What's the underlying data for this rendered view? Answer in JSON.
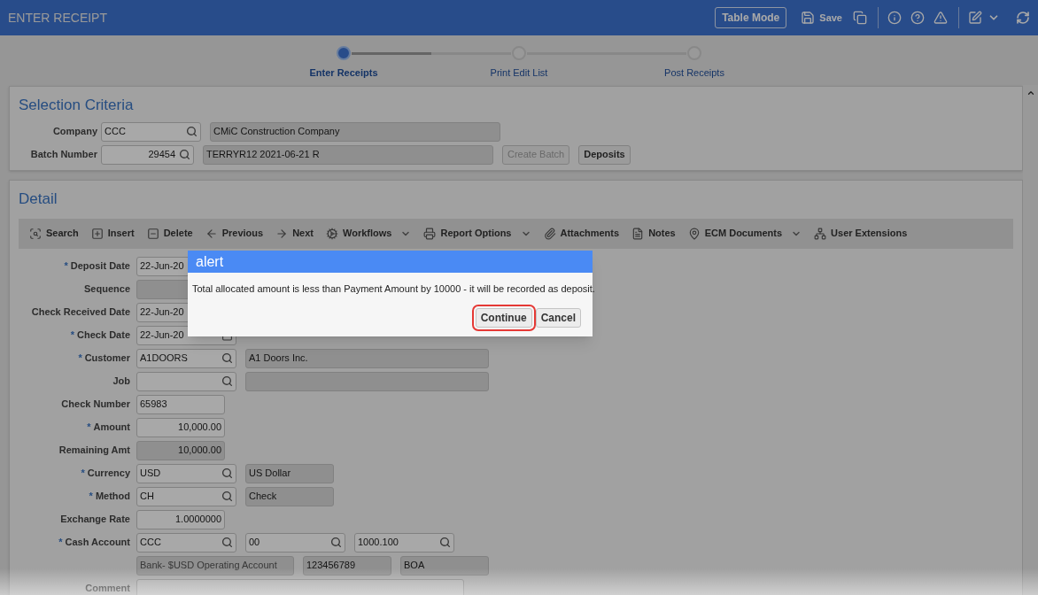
{
  "header": {
    "title": "ENTER RECEIPT",
    "table_mode": "Table Mode",
    "save": "Save"
  },
  "stepper": {
    "level": 0.5,
    "steps": [
      {
        "label": "Enter Receipts",
        "selected": true
      },
      {
        "label": "Print Edit List",
        "selected": false
      },
      {
        "label": "Post Receipts",
        "selected": false
      }
    ]
  },
  "selection_criteria": {
    "title": "Selection Criteria",
    "rows": [
      {
        "label": "Company",
        "fields": [
          {
            "kind": "lookup",
            "value": "CCC"
          },
          {
            "kind": "name",
            "value": "CMiC Construction Company"
          }
        ]
      },
      {
        "label": "Batch Number",
        "fields": [
          {
            "kind": "lookup_number",
            "value": "29454"
          },
          {
            "kind": "name",
            "value": "TERRYR12 2021-06-21 R"
          }
        ],
        "buttons": [
          {
            "label": "Create Batch",
            "disabled": true
          },
          {
            "label": "Deposits",
            "disabled": false
          }
        ]
      }
    ]
  },
  "detail": {
    "title": "Detail",
    "toolbar": [
      {
        "label": "Search",
        "kind": "button"
      },
      {
        "label": "Insert",
        "kind": "button"
      },
      {
        "label": "Delete",
        "kind": "button"
      },
      {
        "label": "Previous",
        "kind": "button"
      },
      {
        "label": "Next",
        "kind": "button"
      },
      {
        "label": "Workflows",
        "kind": "menu"
      },
      {
        "label": "Report Options",
        "kind": "menu"
      },
      {
        "label": "Attachments",
        "kind": "button"
      },
      {
        "label": "Notes",
        "kind": "button"
      },
      {
        "label": "ECM Documents",
        "kind": "menu"
      },
      {
        "label": "User Extensions",
        "kind": "button"
      }
    ],
    "rows": [
      {
        "label": "Deposit Date",
        "marker": "*",
        "fields": [
          {
            "kind": "date_covered",
            "value": "22-Jun-20"
          }
        ]
      },
      {
        "label": "Sequence",
        "fields": [
          {
            "kind": "display"
          }
        ]
      },
      {
        "label": "Check Received Date",
        "fields": [
          {
            "kind": "date_covered",
            "value": "22-Jun-20"
          }
        ]
      },
      {
        "label": "Check Date",
        "marker": "*",
        "fields": [
          {
            "kind": "date",
            "value": "22-Jun-20"
          }
        ]
      },
      {
        "label": "Customer",
        "marker": "*",
        "fields": [
          {
            "kind": "lookup",
            "value": "A1DOORS"
          },
          {
            "kind": "name",
            "value": "A1 Doors Inc."
          }
        ]
      },
      {
        "label": "Job",
        "fields": [
          {
            "kind": "lookup"
          },
          {
            "kind": "name"
          }
        ]
      },
      {
        "label": "Check Number",
        "fields": [
          {
            "kind": "entry",
            "value": "65983"
          }
        ]
      },
      {
        "label": "Amount",
        "marker": "*",
        "fields": [
          {
            "kind": "amount",
            "value": "10,000.00"
          }
        ]
      },
      {
        "label": "Remaining Amt",
        "fields": [
          {
            "kind": "amount_display",
            "value": "10,000.00"
          }
        ]
      },
      {
        "label": "Currency",
        "marker": "*",
        "fields": [
          {
            "kind": "lookup",
            "value": "USD"
          },
          {
            "kind": "display",
            "value": "US Dollar"
          }
        ]
      },
      {
        "label": "Method",
        "marker": "*",
        "fields": [
          {
            "kind": "lookup",
            "value": "CH"
          },
          {
            "kind": "display",
            "value": "Check"
          }
        ]
      },
      {
        "label": "Exchange Rate",
        "fields": [
          {
            "kind": "amount",
            "value": "1.0000000"
          }
        ]
      },
      {
        "label": "Cash Account",
        "marker": "*",
        "fields": [
          {
            "kind": "lookup",
            "value": "CCC"
          },
          {
            "kind": "lookup",
            "value": "00"
          },
          {
            "kind": "lookup",
            "value": "1000.100"
          }
        ]
      },
      {
        "fields": [
          {
            "kind": "account",
            "value": "Bank- $USD Operating Account"
          },
          {
            "kind": "display",
            "value": "123456789"
          },
          {
            "kind": "display",
            "value": "BOA"
          }
        ]
      },
      {
        "label": "Comment",
        "fields": [
          {
            "kind": "note"
          }
        ]
      }
    ]
  },
  "alert": {
    "title": "alert",
    "message": "Total allocated amount is less than Payment Amount by 10000 - it will be recorded as deposit.",
    "buttons": [
      {
        "label": "Continue",
        "highlighted": true
      },
      {
        "label": "Cancel",
        "highlighted": false
      }
    ]
  }
}
